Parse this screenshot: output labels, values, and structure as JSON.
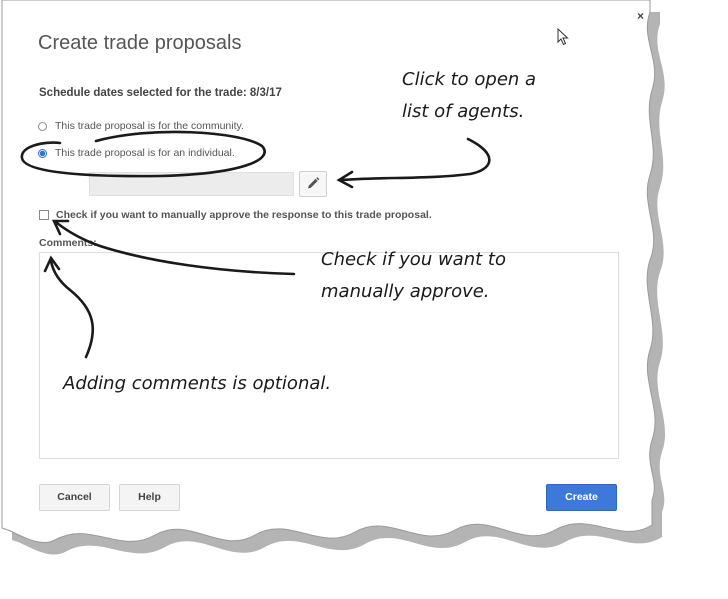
{
  "dialog": {
    "title": "Create trade proposals",
    "close_label": "×",
    "schedule_label": "Schedule dates selected for the trade: 8/3/17",
    "options": [
      {
        "label": "This trade proposal is for the community.",
        "selected": false
      },
      {
        "label": "This trade proposal is for an individual.",
        "selected": true
      }
    ],
    "agent_field": {
      "value": "",
      "placeholder": ""
    },
    "manual_approve": {
      "label": "Check if you want to manually approve the response to this trade proposal.",
      "checked": false
    },
    "comments": {
      "label": "Comments:",
      "value": ""
    },
    "buttons": {
      "cancel": "Cancel",
      "help": "Help",
      "create": "Create"
    }
  },
  "annotations": {
    "agents_line1": "Click to open a",
    "agents_line2": "list of agents.",
    "approve_line1": "Check if you want to",
    "approve_line2": "manually approve.",
    "comments_note": "Adding comments is optional."
  },
  "colors": {
    "accent": "#3c79d8",
    "text": "#555555",
    "annotation": "#1a1a1a"
  },
  "icons": [
    "close-icon",
    "pencil-icon",
    "mouse-cursor-icon"
  ]
}
